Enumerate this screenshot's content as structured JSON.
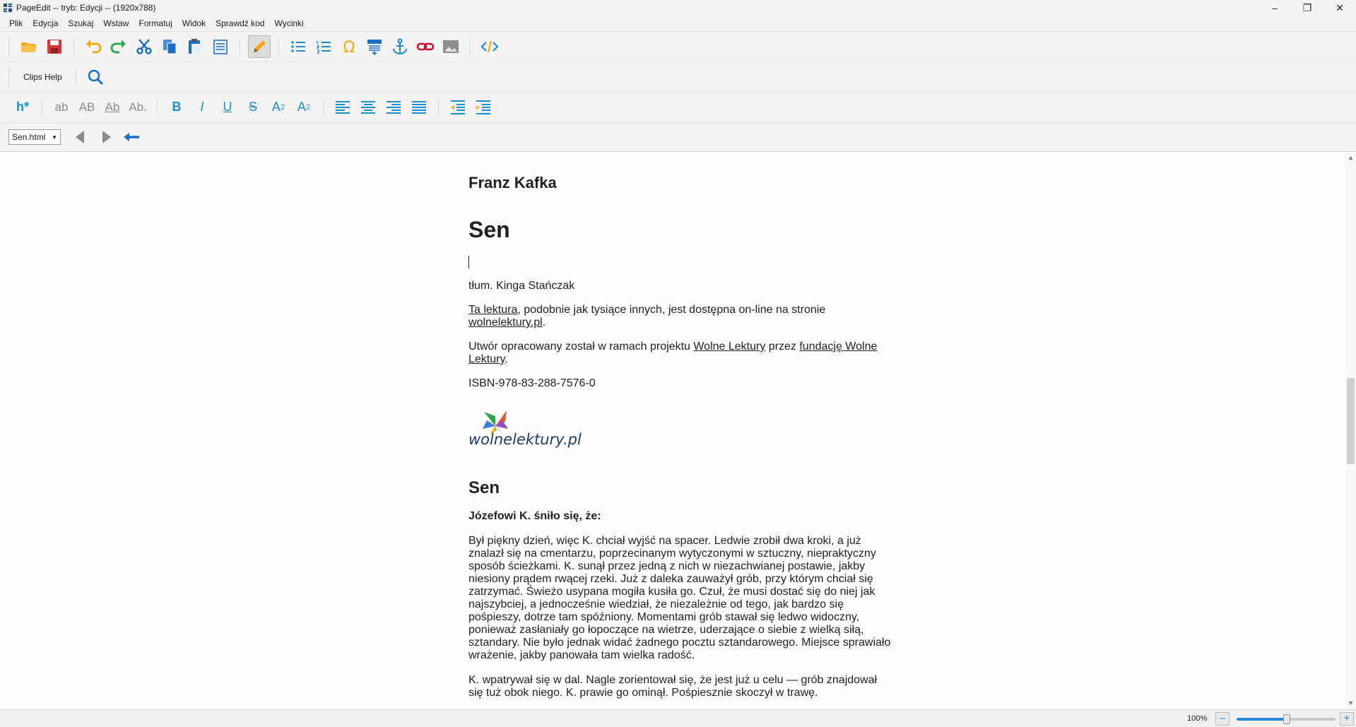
{
  "window": {
    "title": "PageEdit -- tryb: Edycji -- (1920x788)"
  },
  "menu": [
    "Plik",
    "Edycja",
    "Szukaj",
    "Wstaw",
    "Formatuj",
    "Widok",
    "Sprawdź kod",
    "Wycinki"
  ],
  "clips": {
    "label": "Clips Help"
  },
  "format": {
    "heading": "h*",
    "lowercase": "ab",
    "uppercase": "AB",
    "titlecase": "Ab",
    "sentencecase": "Ab.",
    "bold": "B",
    "italic": "I",
    "underline": "U",
    "strike": "S",
    "sub": "A",
    "sub_mark": "2",
    "sup": "A",
    "sup_mark": "2"
  },
  "nav": {
    "file": "Sen.html"
  },
  "document": {
    "author": "Franz Kafka",
    "title": "Sen",
    "translator": "tłum. Kinga Stańczak",
    "p1_link1": "Ta lektura",
    "p1_text": ", podobnie jak tysiące innych, jest dostępna on-line na stronie",
    "p1_link2": "wolnelektury.pl",
    "p1_end": ".",
    "p2_text": "Utwór opracowany został w ramach projektu ",
    "p2_link1": "Wolne Lektury",
    "p2_mid": " przez ",
    "p2_link2": "fundację Wolne Lektury",
    "p2_end": ".",
    "isbn": "ISBN-978-83-288-7576-0",
    "logo_text": "wolnelektury.pl",
    "section_title": "Sen",
    "lead": "Józefowi K. śniło się, że:",
    "para1": "Był piękny dzień, więc K. chciał wyjść na spacer. Ledwie zrobił dwa kroki, a już znalazł się na cmentarzu, poprzecinanym wytyczonymi w sztuczny, niepraktyczny sposób ścieżkami. K. sunął przez jedną z nich w niezachwianej postawie, jakby niesiony prądem rwącej rzeki. Już z daleka zauważył grób, przy którym chciał się zatrzymać. Świeżo usypana mogiła kusiła go. Czuł, że musi dostać się do niej jak najszybciej, a jednocześnie wiedział, że niezależnie od tego, jak bardzo się pośpieszy, dotrze tam spóźniony. Momentami grób stawał się ledwo widoczny, ponieważ zasłaniały go łopoczące na wietrze, uderzające o siebie z wielką siłą, sztandary. Nie było jednak widać żadnego pocztu sztandarowego. Miejsce sprawiało wrażenie, jakby panowała tam wielka radość.",
    "para2": "K. wpatrywał się w dal. Nagle zorientował się, że jest już u celu — grób znajdował się tuż obok niego. K. prawie go ominął. Pośpiesznie skoczył w trawę."
  },
  "status": {
    "zoom": "100%"
  },
  "colors": {
    "accent": "#1a8fd0",
    "folder": "#f3a81b",
    "save": "#d6343b",
    "link": "#c8102e"
  }
}
